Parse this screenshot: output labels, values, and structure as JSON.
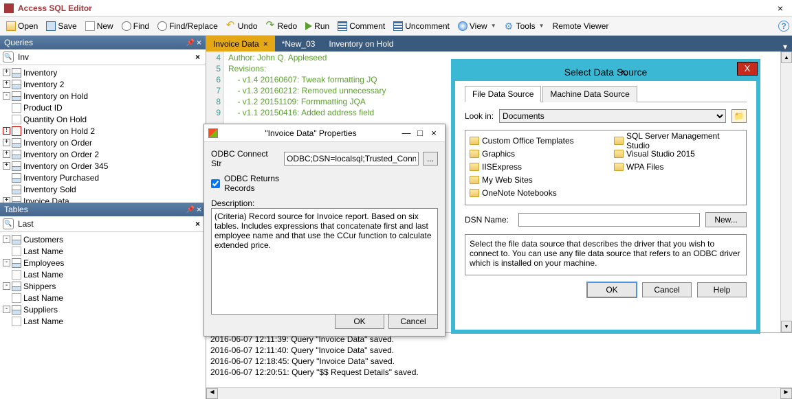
{
  "app": {
    "title": "Access SQL Editor"
  },
  "toolbar": {
    "open": "Open",
    "save": "Save",
    "new": "New",
    "find": "Find",
    "findreplace": "Find/Replace",
    "undo": "Undo",
    "redo": "Redo",
    "run": "Run",
    "comment": "Comment",
    "uncomment": "Uncomment",
    "view": "View",
    "tools": "Tools",
    "remote": "Remote Viewer"
  },
  "queries": {
    "header": "Queries",
    "filter": "Inv",
    "items": [
      {
        "label": "Inventory",
        "exp": "+"
      },
      {
        "label": "Inventory 2",
        "exp": "+"
      },
      {
        "label": "Inventory on Hold",
        "exp": "-",
        "children": [
          {
            "label": "Product ID"
          },
          {
            "label": "Quantity On Hold"
          }
        ]
      },
      {
        "label": "Inventory on Hold 2",
        "exp": "!",
        "ic": "invoice"
      },
      {
        "label": "Inventory on Order",
        "exp": "+"
      },
      {
        "label": "Inventory on Order 2",
        "exp": "+"
      },
      {
        "label": "Inventory on Order 345",
        "exp": "+"
      },
      {
        "label": "Inventory Purchased",
        "exp": ""
      },
      {
        "label": "Inventory Sold",
        "exp": ""
      },
      {
        "label": "Invoice Data",
        "exp": "+"
      }
    ]
  },
  "tables": {
    "header": "Tables",
    "filter": "Last",
    "items": [
      {
        "label": "Customers",
        "exp": "-",
        "children": [
          {
            "label": "Last Name"
          }
        ]
      },
      {
        "label": "Employees",
        "exp": "-",
        "children": [
          {
            "label": "Last Name"
          }
        ]
      },
      {
        "label": "Shippers",
        "exp": "-",
        "children": [
          {
            "label": "Last Name"
          }
        ]
      },
      {
        "label": "Suppliers",
        "exp": "-",
        "children": [
          {
            "label": "Last Name"
          }
        ]
      }
    ]
  },
  "tabs": [
    {
      "label": "Invoice Data",
      "active": true
    },
    {
      "label": "*New_03",
      "active": false
    },
    {
      "label": "Inventory on Hold",
      "active": false
    }
  ],
  "editor": {
    "lines": [
      {
        "n": 4,
        "text": "Author: John Q. Appleseed"
      },
      {
        "n": 5,
        "text": "Revisions:"
      },
      {
        "n": 6,
        "text": "    - v1.4 20160607: Tweak formatting JQ"
      },
      {
        "n": 7,
        "text": "    - v1.3 20160212: Removed unnecessary"
      },
      {
        "n": 8,
        "text": "    - v1.2 20151109: Formmatting JQA"
      },
      {
        "n": 9,
        "text": "    - v1.1 20150416: Added address field"
      }
    ]
  },
  "log": [
    "2016-06-07 12:11:39: Query \"Invoice Data\" saved.",
    "2016-06-07 12:11:40: Query \"Invoice Data\" saved.",
    "2016-06-07 12:18:45: Query \"Invoice Data\" saved.",
    "2016-06-07 12:20:51: Query \"$$ Request Details\" saved."
  ],
  "propdlg": {
    "title": "\"Invoice Data\" Properties",
    "odbc_label": "ODBC Connect Str",
    "odbc_value": "ODBC;DSN=localsql;Trusted_Connection=",
    "returns_label": "ODBC Returns Records",
    "returns_checked": true,
    "desc_label": "Description:",
    "desc_text": "(Criteria) Record source for Invoice report. Based on six tables. Includes expressions that concatenate first and last employee name and that use the CCur function to calculate extended price.",
    "ok": "OK",
    "cancel": "Cancel"
  },
  "dsdlg": {
    "title": "Select Data Source",
    "tab1": "File Data Source",
    "tab2": "Machine Data Source",
    "lookin_label": "Look in:",
    "lookin_value": "Documents",
    "folders_left": [
      "Custom Office Templates",
      "Graphics",
      "IISExpress",
      "My Web Sites",
      "OneNote Notebooks"
    ],
    "folders_right": [
      "SQL Server Management Studio",
      "Visual Studio 2015",
      "WPA Files"
    ],
    "dsn_label": "DSN Name:",
    "dsn_value": "",
    "new": "New...",
    "help_text": "Select the file data source that describes the driver that you wish to connect to. You can use any file data source that refers to an ODBC driver which is installed on your machine.",
    "ok": "OK",
    "cancel": "Cancel",
    "help": "Help"
  }
}
